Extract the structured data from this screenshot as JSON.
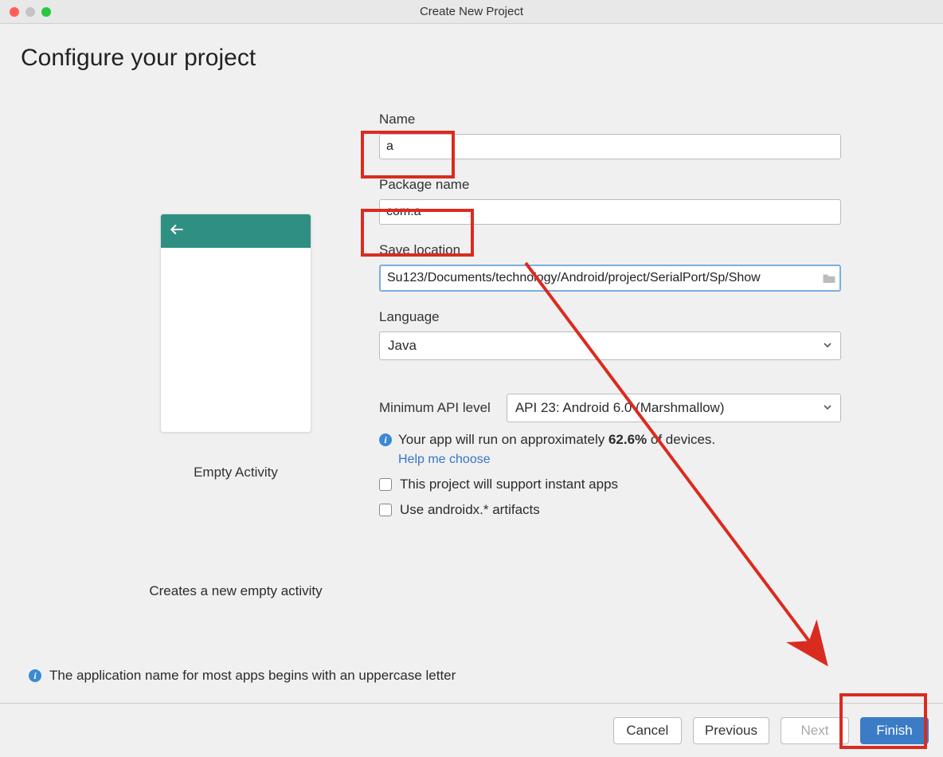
{
  "window": {
    "title": "Create New Project"
  },
  "page": {
    "heading": "Configure your project",
    "previewName": "Empty Activity",
    "previewDescription": "Creates a new empty activity"
  },
  "fields": {
    "name": {
      "label": "Name",
      "value": "a"
    },
    "packageName": {
      "label": "Package name",
      "value": "com.a"
    },
    "saveLocation": {
      "label": "Save location",
      "value": "Su123/Documents/technology/Android/project/SerialPort/Sp/Show"
    },
    "language": {
      "label": "Language",
      "value": "Java"
    },
    "minApi": {
      "label": "Minimum API level",
      "value": "API 23: Android 6.0 (Marshmallow)"
    }
  },
  "info": {
    "compatPrefix": "Your app will run on approximately ",
    "compatPercent": "62.6%",
    "compatSuffix": " of devices.",
    "helpLink": "Help me choose",
    "instantApps": "This project will support instant apps",
    "androidx": "Use androidx.* artifacts"
  },
  "footerInfo": "The application name for most apps begins with an uppercase letter",
  "buttons": {
    "cancel": "Cancel",
    "previous": "Previous",
    "next": "Next",
    "finish": "Finish"
  }
}
